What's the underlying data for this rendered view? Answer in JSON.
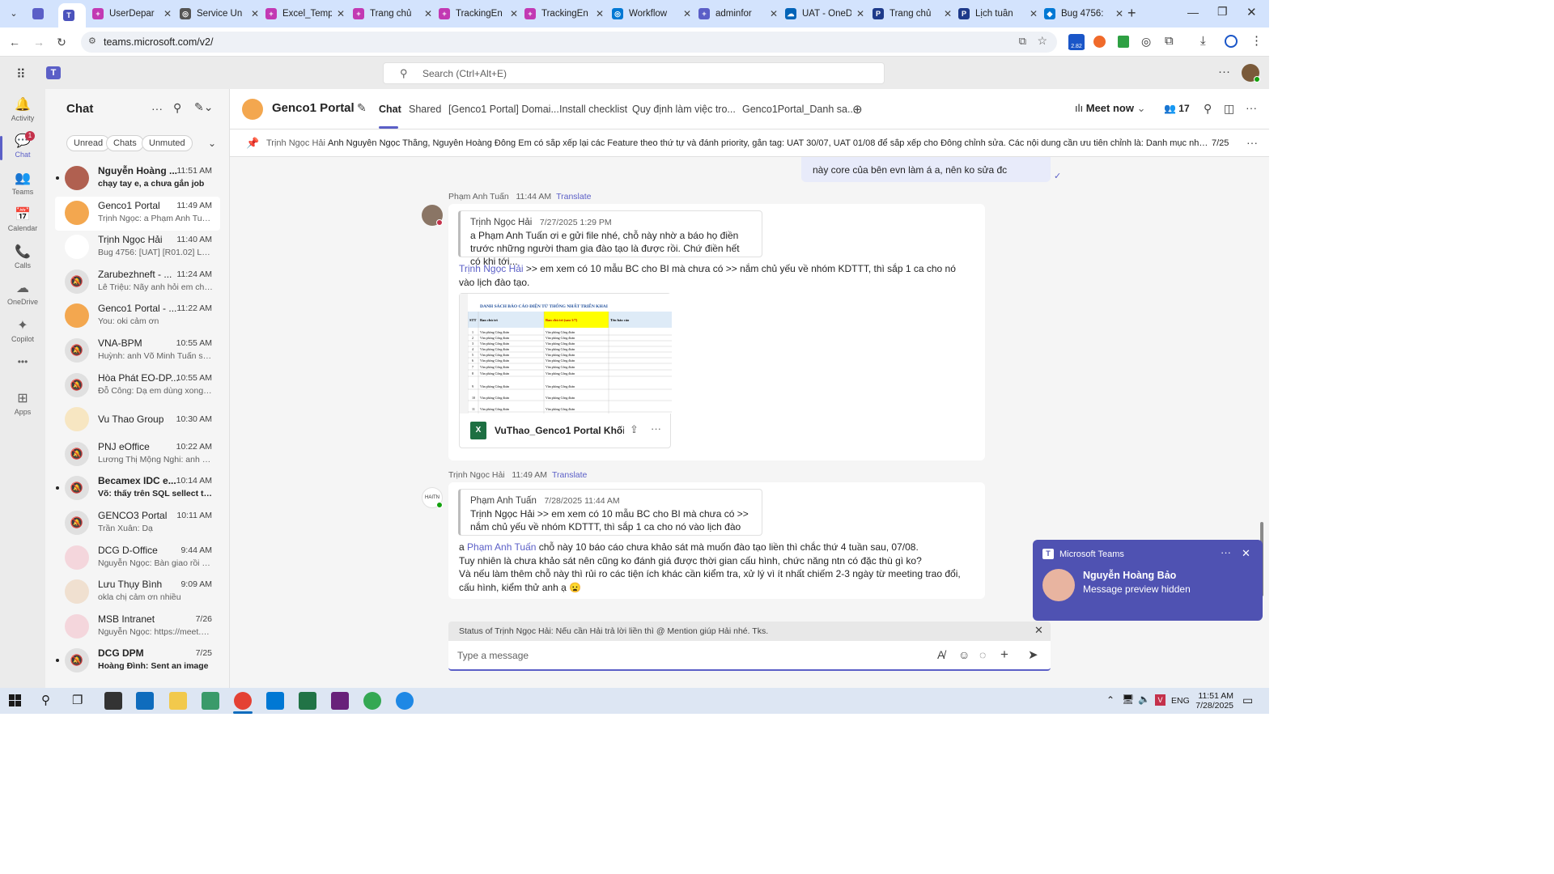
{
  "browser": {
    "tabs": [
      {
        "label": "",
        "color": "#5b5fc7",
        "glyph": ""
      },
      {
        "label": "",
        "color": "#4b53bc",
        "glyph": "T"
      },
      {
        "label": "UserDepar",
        "color": "#c239b3",
        "glyph": "+"
      },
      {
        "label": "Service Un",
        "color": "#555555",
        "glyph": "◎"
      },
      {
        "label": "Excel_Temp",
        "color": "#c239b3",
        "glyph": "+"
      },
      {
        "label": "Trang chủ",
        "color": "#c239b3",
        "glyph": "+"
      },
      {
        "label": "TrackingEn",
        "color": "#c239b3",
        "glyph": "+"
      },
      {
        "label": "TrackingEn",
        "color": "#c239b3",
        "glyph": "+"
      },
      {
        "label": "Workflow",
        "color": "#0078d4",
        "glyph": "◎"
      },
      {
        "label": "adminfor",
        "color": "#5b5fc7",
        "glyph": "+"
      },
      {
        "label": "UAT - OneD",
        "color": "#0364b8",
        "glyph": "☁"
      },
      {
        "label": "Trang chủ",
        "color": "#1e3a8a",
        "glyph": "P"
      },
      {
        "label": "Lịch tuần",
        "color": "#1e3a8a",
        "glyph": "P"
      },
      {
        "label": "Bug 4756:",
        "color": "#0078d4",
        "glyph": "◆"
      }
    ],
    "url": "teams.microsoft.com/v2/",
    "ext_badge": "2.82"
  },
  "teams": {
    "search_placeholder": "Search (Ctrl+Alt+E)",
    "rail": [
      {
        "label": "Activity",
        "icon": "bell-icon",
        "glyph": "🔔"
      },
      {
        "label": "Chat",
        "icon": "chat-icon",
        "glyph": "💬",
        "badge": "1"
      },
      {
        "label": "Teams",
        "icon": "teams-icon",
        "glyph": "👥"
      },
      {
        "label": "Calendar",
        "icon": "calendar-icon",
        "glyph": "📅"
      },
      {
        "label": "Calls",
        "icon": "phone-icon",
        "glyph": "📞"
      },
      {
        "label": "OneDrive",
        "icon": "cloud-icon",
        "glyph": "☁"
      },
      {
        "label": "Copilot",
        "icon": "copilot-icon",
        "glyph": "✦"
      },
      {
        "label": "",
        "icon": "more-icon",
        "glyph": "•••"
      },
      {
        "label": "Apps",
        "icon": "apps-icon",
        "glyph": "⊞"
      }
    ]
  },
  "chatlist": {
    "title": "Chat",
    "filters": [
      "Unread",
      "Chats",
      "Unmuted"
    ],
    "items": [
      {
        "name": "Nguyễn Hoàng ...",
        "time": "11:51 AM",
        "preview": "chạy tay e, a chưa gắn job",
        "unread": true
      },
      {
        "name": "Genco1 Portal",
        "time": "11:49 AM",
        "preview": "Trịnh Ngọc: a Phạm Anh Tuấn ...",
        "selected": true
      },
      {
        "name": "Trịnh Ngọc Hải",
        "time": "11:40 AM",
        "preview": "Bug 4756: [UAT] [R01.02] Lỗi c..."
      },
      {
        "name": "Zarubezhneft - ...",
        "time": "11:24 AM",
        "preview": "Lê Triệu: Nãy anh hỏi em chỗ ..."
      },
      {
        "name": "Genco1 Portal - ...",
        "time": "11:22 AM",
        "preview": "You: oki cảm ơn"
      },
      {
        "name": "VNA-BPM",
        "time": "10:55 AM",
        "preview": "Huỳnh: anh Võ Minh Tuấn setu..."
      },
      {
        "name": "Hòa Phát EO-DP...",
        "time": "10:55 AM",
        "preview": "Đỗ Công: Dạ em dùng xong rồi..."
      },
      {
        "name": "Vu Thao Group",
        "time": "10:30 AM",
        "preview": ""
      },
      {
        "name": "PNJ eOffice",
        "time": "10:22 AM",
        "preview": "Lương Thị Mộng Nghi: anh Võ ..."
      },
      {
        "name": "Becamex IDC e...",
        "time": "10:14 AM",
        "preview": "Võ: thấy trên SQL sellect table...",
        "unread": true
      },
      {
        "name": "GENCO3 Portal",
        "time": "10:11 AM",
        "preview": "Trần Xuân: Dạ"
      },
      {
        "name": "DCG D-Office",
        "time": "9:44 AM",
        "preview": "Nguyễn Ngọc: Bàn giao rồi chị D..."
      },
      {
        "name": "Lưu Thụy Bình",
        "time": "9:09 AM",
        "preview": "okla chị cảm ơn nhiều"
      },
      {
        "name": "MSB Intranet",
        "time": "7/26",
        "preview": "Nguyễn Ngọc: https://meet.go..."
      },
      {
        "name": "DCG DPM",
        "time": "7/25",
        "preview": "Hoàng Đình: Sent an image",
        "unread": true
      }
    ]
  },
  "channel": {
    "name": "Genco1 Portal",
    "tabs": [
      "Chat",
      "Shared",
      "[Genco1 Portal] Domai...",
      "Install checklist",
      "Quy định làm việc tro...",
      "Genco1Portal_Danh sa..."
    ],
    "meet_now": "Meet now",
    "participants": "17",
    "pinned": {
      "author": "Trịnh Ngọc Hải",
      "text": "Anh Nguyễn Ngọc Thắng, Nguyễn Hoàng Đông Em có sắp xếp lại các Feature theo thứ tự và đánh priority, gắn tag: UAT 30/07, UAT 01/08 để sắp xếp cho Đông chỉnh sửa. Các nội dung cần ưu tiên chỉnh là: Danh mục nhân viên: Trao đổi trở đùn...",
      "count": "7/25"
    }
  },
  "messages": {
    "prev_tail": "này core của bên evn làm  á a, nên ko sửa đc",
    "m1": {
      "author": "Phạm Anh Tuấn",
      "time": "11:44 AM",
      "translate": "Translate",
      "quote_author": "Trịnh Ngọc Hải",
      "quote_time": "7/27/2025 1:29 PM",
      "quote_text": "a Phạm Anh Tuấn ơi e gửi file nhé, chỗ này nhờ a báo họ điền trước những người tham gia đào tạo là được rồi. Chứ điền hết có khi tới...",
      "mention": "Trịnh Ngọc Hải",
      "text": " >> em xem có 10 mẫu BC cho BI mà chưa có >> nắm chủ yếu về nhóm KDTTT, thì sắp 1 ca cho nó vào lịch đào tạo.",
      "file_name": "VuThao_Genco1 Portal Khối I...",
      "sheet_title": "DANH SÁCH BÁO CÁO ĐIỆN TỬ THỐNG NHẤT TRIỂN KHAI",
      "sheet_cols": [
        "STT",
        "Ban chủ trì",
        "Ban chủ trì (sau 1/7)",
        "Tên báo cáo"
      ],
      "sheet_row_text": "Văn phòng Công đoàn"
    },
    "m2": {
      "author": "Trịnh Ngọc Hải",
      "time": "11:49 AM",
      "translate": "Translate",
      "quote_author": "Phạm Anh Tuấn",
      "quote_time": "7/28/2025 11:44 AM",
      "quote_text": "Trịnh Ngọc Hải >> em xem có 10 mẫu BC cho BI mà chưa có >> nắm chủ yếu về nhóm KDTTT, thì sắp 1 ca cho nó vào lịch đào tạo. 📄...",
      "line1_pre": "a ",
      "mention": "Phạm Anh Tuấn",
      "line1_post": " chỗ này 10 báo cáo chưa khảo sát mà muốn đào tạo liền thì chắc thứ 4 tuần sau, 07/08.",
      "line2": "Tuy nhiên là chưa khảo sát nên cũng ko đánh giá được thời gian cấu hình, chức năng ntn có đặc thù gì ko?",
      "line3": "Và nếu làm thêm chỗ này thì rủi ro các tiện ích khác cần kiểm tra, xử lý vì ít nhất chiếm 2-3 ngày từ meeting trao đổi, cấu hình, kiểm thử anh ạ 😦"
    }
  },
  "compose": {
    "status": "Status of Trịnh Ngọc Hải: Nếu cần Hải trả lời liền thì @ Mention giúp Hải nhé. Tks.",
    "placeholder": "Type a message"
  },
  "toast": {
    "app": "Microsoft Teams",
    "name": "Nguyễn Hoàng Bảo",
    "text": "Message preview hidden"
  },
  "taskbar": {
    "time": "11:51 AM",
    "date": "7/28/2025",
    "lang": "ENG"
  }
}
